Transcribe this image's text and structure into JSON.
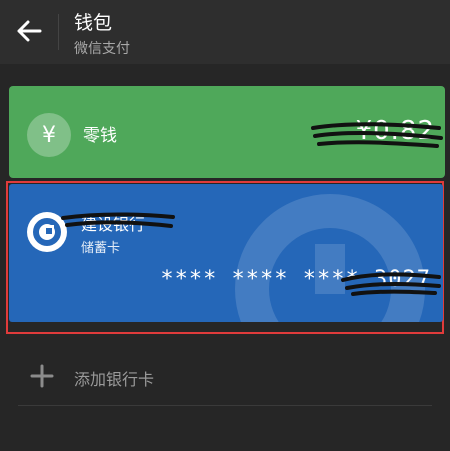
{
  "header": {
    "title": "钱包",
    "subtitle": "微信支付",
    "back_icon": "arrow-left-icon"
  },
  "wallet": {
    "label": "零钱",
    "amount": "¥0.82",
    "icon": "yuan-icon",
    "color": "#4fa85a"
  },
  "bank_card": {
    "name": "建设银行",
    "type": "储蓄卡",
    "number": "**** **** **** 3027",
    "icon": "ccb-logo-icon",
    "color": "#2567b8"
  },
  "add_card": {
    "label": "添加银行卡",
    "icon": "plus-icon"
  },
  "colors": {
    "background": "#262626",
    "header": "#2e2e2e",
    "highlight": "#e03b3b"
  }
}
